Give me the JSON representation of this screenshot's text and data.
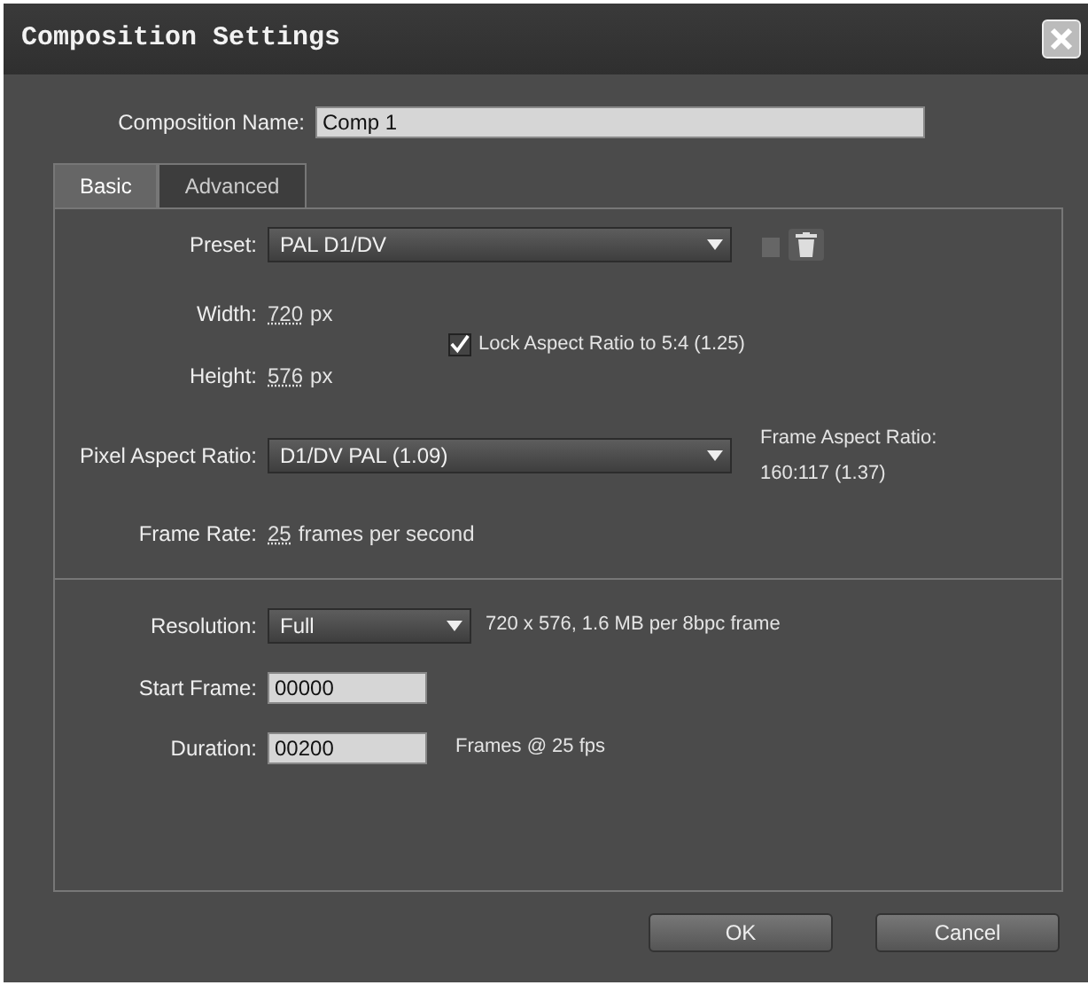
{
  "window": {
    "title": "Composition Settings"
  },
  "composition_name": {
    "label": "Composition Name:",
    "value": "Comp 1"
  },
  "tabs": [
    {
      "label": "Basic",
      "selected": true
    },
    {
      "label": "Advanced",
      "selected": false
    }
  ],
  "basic": {
    "preset": {
      "label": "Preset:",
      "value": "PAL D1/DV"
    },
    "width": {
      "label": "Width:",
      "value": "720",
      "unit": "px"
    },
    "lock_aspect_ratio": {
      "label": "Lock Aspect Ratio to 5:4 (1.25)",
      "checked": true
    },
    "height": {
      "label": "Height:",
      "value": "576",
      "unit": "px"
    },
    "pixel_aspect_ratio": {
      "label": "Pixel Aspect Ratio:",
      "value": "D1/DV PAL (1.09)"
    },
    "frame_aspect_ratio": {
      "label": "Frame Aspect Ratio:",
      "value": "160:117 (1.37)"
    },
    "frame_rate": {
      "label": "Frame Rate:",
      "value": "25",
      "unit": "frames per second"
    },
    "resolution": {
      "label": "Resolution:",
      "value": "Full",
      "info": "720 x 576, 1.6 MB per 8bpc frame"
    },
    "start_frame": {
      "label": "Start Frame:",
      "value": "00000"
    },
    "duration": {
      "label": "Duration:",
      "value": "00200",
      "note": "Frames @ 25 fps"
    }
  },
  "buttons": [
    {
      "label": "OK"
    },
    {
      "label": "Cancel"
    }
  ]
}
